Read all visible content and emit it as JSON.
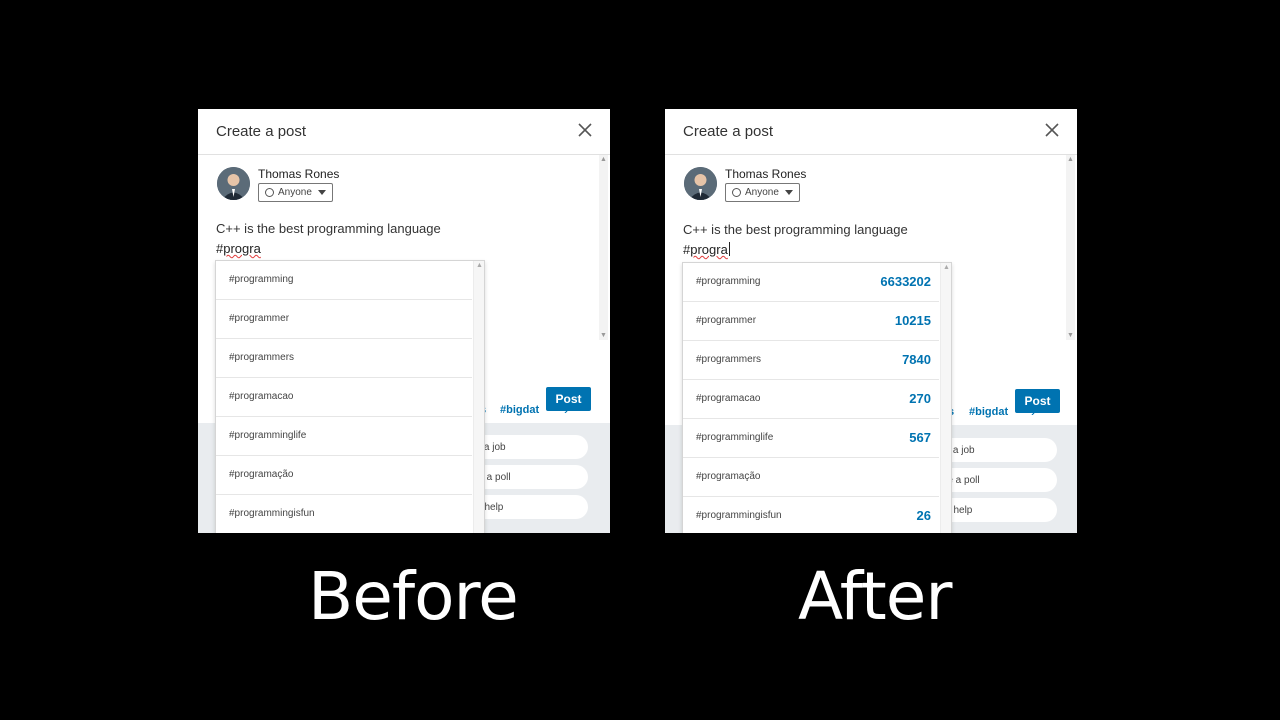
{
  "colors": {
    "accent": "#0073b1",
    "background": "#000000"
  },
  "before": {
    "caption": "Before",
    "dialog": {
      "title": "Create a post",
      "author": "Thomas Rones",
      "audience": "Anyone",
      "line1": "C++ is the best programming language",
      "line2_hash": "#",
      "line2_word": "progra",
      "tag_partial": "s",
      "tag_visible": "#bigdat",
      "chevron": "›",
      "post_button": "Post",
      "actions": [
        "dd a job",
        "ate a poll",
        "fer help"
      ]
    },
    "suggestions": [
      {
        "tag": "#programming"
      },
      {
        "tag": "#programmer"
      },
      {
        "tag": "#programmers"
      },
      {
        "tag": "#programacao"
      },
      {
        "tag": "#programminglife"
      },
      {
        "tag": "#programação"
      },
      {
        "tag": "#programmingisfun"
      }
    ]
  },
  "after": {
    "caption": "After",
    "dialog": {
      "title": "Create a post",
      "author": "Thomas Rones",
      "audience": "Anyone",
      "line1": "C++ is the best programming language",
      "line2_hash": "#",
      "line2_word": "progra",
      "tag_partial": "s",
      "tag_visible": "#bigdat",
      "chevron": "›",
      "post_button": "Post",
      "actions": [
        "dd a job",
        "ate a poll",
        "fer help"
      ]
    },
    "suggestions": [
      {
        "tag": "#programming",
        "count": "6633202"
      },
      {
        "tag": "#programmer",
        "count": "10215"
      },
      {
        "tag": "#programmers",
        "count": "7840"
      },
      {
        "tag": "#programacao",
        "count": "270"
      },
      {
        "tag": "#programminglife",
        "count": "567"
      },
      {
        "tag": "#programação",
        "count": ""
      },
      {
        "tag": "#programmingisfun",
        "count": "26"
      }
    ]
  }
}
